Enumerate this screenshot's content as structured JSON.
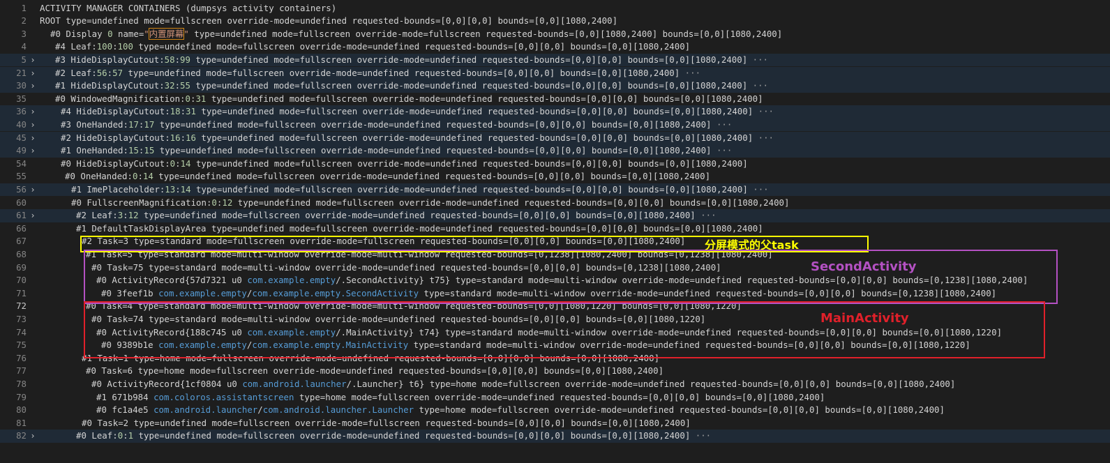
{
  "editor": {
    "lines": [
      {
        "n": "1",
        "indent": 0,
        "text": "ACTIVITY MANAGER CONTAINERS (dumpsys activity containers)"
      },
      {
        "n": "2",
        "indent": 0,
        "text": "ROOT type=undefined mode=fullscreen override-mode=undefined requested-bounds=[0,0][0,0] bounds=[0,0][1080,2400]"
      },
      {
        "n": "3",
        "indent": 1,
        "text": "#0 Display 0 name=\"内置屏幕\" type=undefined mode=fullscreen override-mode=fullscreen requested-bounds=[0,0][1080,2400] bounds=[0,0][1080,2400]"
      },
      {
        "n": "4",
        "indent": 2,
        "text": "#4 Leaf:100:100 type=undefined mode=fullscreen override-mode=undefined requested-bounds=[0,0][0,0] bounds=[0,0][1080,2400]"
      },
      {
        "n": "5",
        "indent": 2,
        "folded": true,
        "text": "#3 HideDisplayCutout:58:99 type=undefined mode=fullscreen override-mode=undefined requested-bounds=[0,0][0,0] bounds=[0,0][1080,2400]"
      },
      {
        "n": "21",
        "indent": 2,
        "folded": true,
        "text": "#2 Leaf:56:57 type=undefined mode=fullscreen override-mode=undefined requested-bounds=[0,0][0,0] bounds=[0,0][1080,2400]"
      },
      {
        "n": "30",
        "indent": 2,
        "folded": true,
        "text": "#1 HideDisplayCutout:32:55 type=undefined mode=fullscreen override-mode=undefined requested-bounds=[0,0][0,0] bounds=[0,0][1080,2400]"
      },
      {
        "n": "35",
        "indent": 2,
        "text": "#0 WindowedMagnification:0:31 type=undefined mode=fullscreen override-mode=undefined requested-bounds=[0,0][0,0] bounds=[0,0][1080,2400]"
      },
      {
        "n": "36",
        "indent": 3,
        "folded": true,
        "text": "#4 HideDisplayCutout:18:31 type=undefined mode=fullscreen override-mode=undefined requested-bounds=[0,0][0,0] bounds=[0,0][1080,2400]"
      },
      {
        "n": "40",
        "indent": 3,
        "folded": true,
        "text": "#3 OneHanded:17:17 type=undefined mode=fullscreen override-mode=undefined requested-bounds=[0,0][0,0] bounds=[0,0][1080,2400]"
      },
      {
        "n": "45",
        "indent": 3,
        "folded": true,
        "text": "#2 HideDisplayCutout:16:16 type=undefined mode=fullscreen override-mode=undefined requested-bounds=[0,0][0,0] bounds=[0,0][1080,2400]"
      },
      {
        "n": "49",
        "indent": 3,
        "folded": true,
        "text": "#1 OneHanded:15:15 type=undefined mode=fullscreen override-mode=undefined requested-bounds=[0,0][0,0] bounds=[0,0][1080,2400]"
      },
      {
        "n": "54",
        "indent": 3,
        "text": "#0 HideDisplayCutout:0:14 type=undefined mode=fullscreen override-mode=undefined requested-bounds=[0,0][0,0] bounds=[0,0][1080,2400]"
      },
      {
        "n": "55",
        "indent": 4,
        "text": "#0 OneHanded:0:14 type=undefined mode=fullscreen override-mode=undefined requested-bounds=[0,0][0,0] bounds=[0,0][1080,2400]"
      },
      {
        "n": "56",
        "indent": 5,
        "folded": true,
        "text": "#1 ImePlaceholder:13:14 type=undefined mode=fullscreen override-mode=undefined requested-bounds=[0,0][0,0] bounds=[0,0][1080,2400]"
      },
      {
        "n": "60",
        "indent": 5,
        "text": "#0 FullscreenMagnification:0:12 type=undefined mode=fullscreen override-mode=undefined requested-bounds=[0,0][0,0] bounds=[0,0][1080,2400]"
      },
      {
        "n": "61",
        "indent": 6,
        "folded": true,
        "text": "#2 Leaf:3:12 type=undefined mode=fullscreen override-mode=undefined requested-bounds=[0,0][0,0] bounds=[0,0][1080,2400]"
      },
      {
        "n": "66",
        "indent": 6,
        "text": "#1 DefaultTaskDisplayArea type=undefined mode=fullscreen override-mode=undefined requested-bounds=[0,0][0,0] bounds=[0,0][1080,2400]"
      },
      {
        "n": "67",
        "indent": 7,
        "text": "#2 Task=3 type=standard mode=fullscreen override-mode=fullscreen requested-bounds=[0,0][0,0] bounds=[0,0][1080,2400]"
      },
      {
        "n": "68",
        "indent": 8,
        "text": "#1 Task=5 type=standard mode=multi-window override-mode=multi-window requested-bounds=[0,1238][1080,2400] bounds=[0,1238][1080,2400]"
      },
      {
        "n": "69",
        "indent": 9,
        "text": "#0 Task=75 type=standard mode=multi-window override-mode=undefined requested-bounds=[0,0][0,0] bounds=[0,1238][1080,2400]"
      },
      {
        "n": "70",
        "indent": 10,
        "text": "#0 ActivityRecord{57d7321 u0 com.example.empty/.SecondActivity} t75} type=standard mode=multi-window override-mode=undefined requested-bounds=[0,0][0,0] bounds=[0,1238][1080,2400]"
      },
      {
        "n": "71",
        "indent": 11,
        "text": "#0 3feef1b com.example.empty/com.example.empty.SecondActivity type=standard mode=multi-window override-mode=undefined requested-bounds=[0,0][0,0] bounds=[0,1238][1080,2400]"
      },
      {
        "n": "72",
        "indent": 8,
        "current": true,
        "text": "#0 Task=4 type=standard mode=multi-window override-mode=multi-window requested-bounds=[0,0][1080,1220] bounds=[0,0][1080,1220]"
      },
      {
        "n": "73",
        "indent": 9,
        "text": "#0 Task=74 type=standard mode=multi-window override-mode=undefined requested-bounds=[0,0][0,0] bounds=[0,0][1080,1220]"
      },
      {
        "n": "74",
        "indent": 10,
        "text": "#0 ActivityRecord{188c745 u0 com.example.empty/.MainActivity} t74} type=standard mode=multi-window override-mode=undefined requested-bounds=[0,0][0,0] bounds=[0,0][1080,1220]"
      },
      {
        "n": "75",
        "indent": 11,
        "text": "#0 9389b1e com.example.empty/com.example.empty.MainActivity type=standard mode=multi-window override-mode=undefined requested-bounds=[0,0][0,0] bounds=[0,0][1080,1220]"
      },
      {
        "n": "76",
        "indent": 7,
        "text": "#1 Task=1 type=home mode=fullscreen override-mode=undefined requested-bounds=[0,0][0,0] bounds=[0,0][1080,2400]"
      },
      {
        "n": "77",
        "indent": 8,
        "text": "#0 Task=6 type=home mode=fullscreen override-mode=undefined requested-bounds=[0,0][0,0] bounds=[0,0][1080,2400]"
      },
      {
        "n": "78",
        "indent": 9,
        "text": "#0 ActivityRecord{1cf0804 u0 com.android.launcher/.Launcher} t6} type=home mode=fullscreen override-mode=undefined requested-bounds=[0,0][0,0] bounds=[0,0][1080,2400]"
      },
      {
        "n": "79",
        "indent": 10,
        "text": "#1 671b984 com.coloros.assistantscreen type=home mode=fullscreen override-mode=undefined requested-bounds=[0,0][0,0] bounds=[0,0][1080,2400]"
      },
      {
        "n": "80",
        "indent": 10,
        "text": "#0 fc1a4e5 com.android.launcher/com.android.launcher.Launcher type=home mode=fullscreen override-mode=undefined requested-bounds=[0,0][0,0] bounds=[0,0][1080,2400]"
      },
      {
        "n": "81",
        "indent": 7,
        "text": "#0 Task=2 type=undefined mode=fullscreen override-mode=fullscreen requested-bounds=[0,0][0,0] bounds=[0,0][1080,2400]"
      },
      {
        "n": "82",
        "indent": 6,
        "folded": true,
        "text": "#0 Leaf:0:1 type=undefined mode=fullscreen override-mode=undefined requested-bounds=[0,0][0,0] bounds=[0,0][1080,2400]"
      }
    ],
    "folded_glyph": "›",
    "ellipsis": "···"
  },
  "annotations": {
    "parent_task": {
      "label": "分屏模式的父task",
      "color": "#ffff00"
    },
    "second_activity": {
      "label": "SecondActivity",
      "color": "#b451c3"
    },
    "main_activity": {
      "label": "MainActivity",
      "color": "#e0202a"
    }
  }
}
